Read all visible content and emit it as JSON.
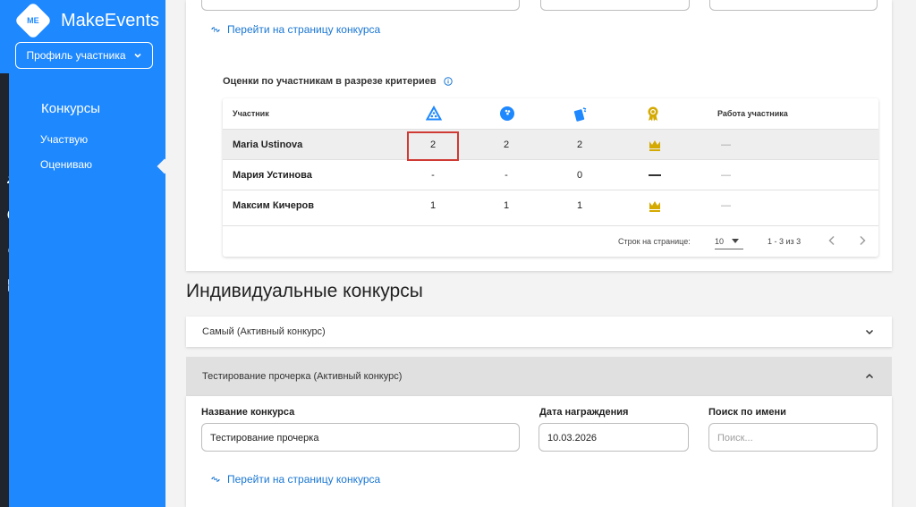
{
  "app": {
    "logo_mark": "ME",
    "name": "MakeEvents"
  },
  "sidebar": {
    "profile_button": "Профиль участника",
    "section": "Конкурсы",
    "items": [
      {
        "label": "Участвую"
      },
      {
        "label": "Оцениваю"
      }
    ]
  },
  "rail_icons": [
    "person-icon",
    "group-icon",
    "chart-icon",
    "globe-icon",
    "qr-icon",
    "clipboard-icon"
  ],
  "top_card": {
    "link": "Перейти на страницу конкурса",
    "subtitle": "Оценки по участникам в разрезе критериев",
    "table": {
      "header_participant": "Участник",
      "header_work": "Работа участника",
      "criteria_icons": [
        "triangle-dots-icon",
        "bowling-ball-icon",
        "cards-icon",
        "award-badge-icon"
      ],
      "rows": [
        {
          "name": "Maria Ustinova",
          "c1": "2",
          "c2": "2",
          "c3": "2",
          "work": "—"
        },
        {
          "name": "Мария Устинова",
          "c1": "-",
          "c2": "-",
          "c3": "0",
          "work": "—"
        },
        {
          "name": "Максим Кичеров",
          "c1": "1",
          "c2": "1",
          "c3": "1",
          "work": "—"
        }
      ],
      "pager": {
        "rows_label": "Строк на странице:",
        "rows_value": "10",
        "range": "1 - 3 из 3"
      }
    }
  },
  "individual": {
    "title": "Индивидуальные конкурсы",
    "accordions": [
      {
        "label": "Самый (Активный конкурс)"
      },
      {
        "label": "Тестирование прочерка (Активный конкурс)"
      }
    ],
    "form": {
      "name_label": "Название конкурса",
      "name_value": "Тестирование прочерка",
      "date_label": "Дата награждения",
      "date_value": "10.03.2026",
      "search_label": "Поиск по имени",
      "search_placeholder": "Поиск..."
    },
    "link": "Перейти на страницу конкурса"
  },
  "colors": {
    "brand_blue": "#1e88ff",
    "rail_dark": "#20252d",
    "link_blue": "#1976d2",
    "crown_gold": "#d4a900",
    "highlight_red": "#d03a34"
  }
}
